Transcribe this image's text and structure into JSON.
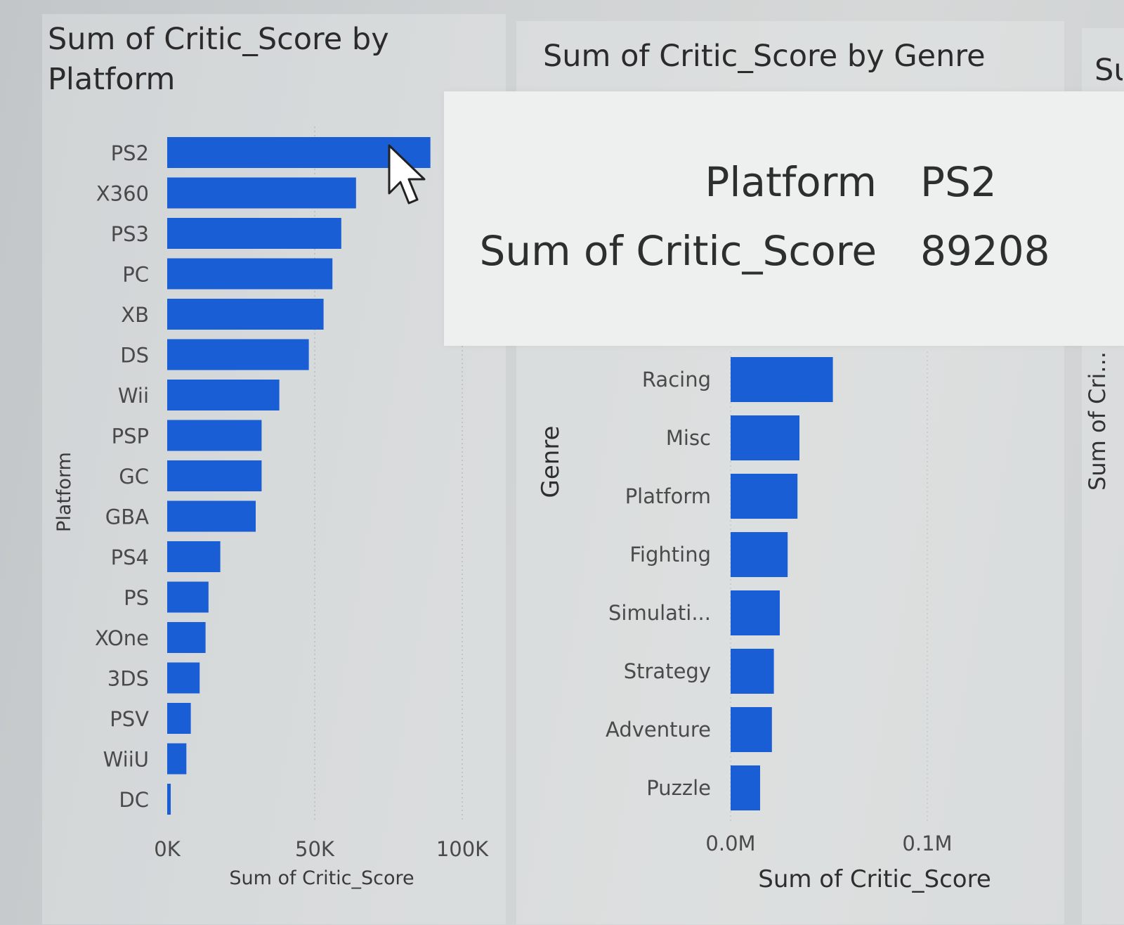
{
  "visual_platform": {
    "title": "Sum of Critic_Score by Platform"
  },
  "visual_genre": {
    "title": "Sum of Critic_Score by Genre"
  },
  "visual_third": {
    "title": "Su",
    "axis_title": "Sum of Cri..."
  },
  "tooltip": {
    "rows": [
      {
        "label": "Platform",
        "value": "PS2"
      },
      {
        "label": "Sum of Critic_Score",
        "value": "89208"
      }
    ]
  },
  "colors": {
    "bar": "#1a5ed6",
    "text": "#3a3a3a"
  },
  "chart_data": [
    {
      "type": "bar",
      "orientation": "horizontal",
      "title": "Sum of Critic_Score by Platform",
      "xlabel": "Sum of Critic_Score",
      "ylabel": "Platform",
      "categories": [
        "PS2",
        "X360",
        "PS3",
        "PC",
        "XB",
        "DS",
        "Wii",
        "PSP",
        "GC",
        "GBA",
        "PS4",
        "PS",
        "XOne",
        "3DS",
        "PSV",
        "WiiU",
        "DC"
      ],
      "values": [
        89208,
        64000,
        59000,
        56000,
        53000,
        48000,
        38000,
        32000,
        32000,
        30000,
        18000,
        14000,
        13000,
        11000,
        8000,
        6500,
        1200
      ],
      "xlim": [
        0,
        100000
      ],
      "x_ticks": [
        0,
        50000,
        100000
      ],
      "x_tick_labels": [
        "0K",
        "50K",
        "100K"
      ],
      "highlighted_category": "PS2"
    },
    {
      "type": "bar",
      "orientation": "horizontal",
      "title": "Sum of Critic_Score by Genre",
      "xlabel": "Sum of Critic_Score",
      "ylabel": "Genre",
      "categories": [
        "Racing",
        "Misc",
        "Platform",
        "Fighting",
        "Simulati...",
        "Strategy",
        "Adventure",
        "Puzzle"
      ],
      "values": [
        52000,
        35000,
        34000,
        29000,
        25000,
        22000,
        21000,
        15000
      ],
      "xlim": [
        0,
        100000
      ],
      "x_ticks": [
        0,
        100000
      ],
      "x_tick_labels": [
        "0.0M",
        "0.1M"
      ]
    }
  ]
}
